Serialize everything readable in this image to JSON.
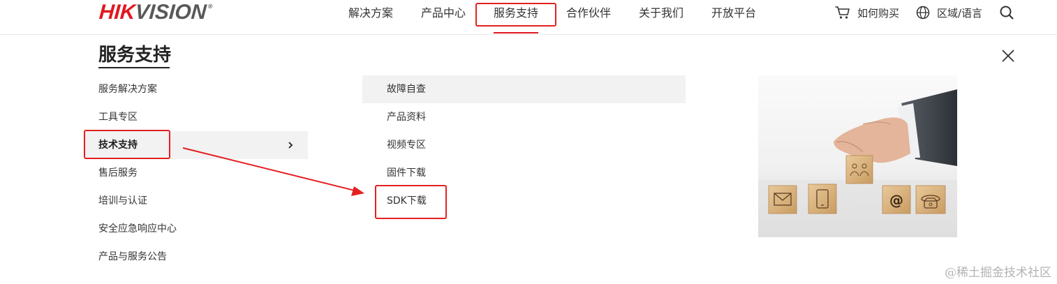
{
  "header": {
    "logo": {
      "part1": "HIK",
      "part2": "VISION",
      "registered": "®"
    },
    "nav": [
      {
        "label": "解决方案"
      },
      {
        "label": "产品中心"
      },
      {
        "label": "服务支持",
        "active": true
      },
      {
        "label": "合作伙伴"
      },
      {
        "label": "关于我们"
      },
      {
        "label": "开放平台"
      }
    ],
    "utilities": {
      "buy_label": "如何购买",
      "region_label": "区域/语言"
    }
  },
  "menu": {
    "title": "服务支持",
    "left_items": [
      {
        "label": "服务解决方案"
      },
      {
        "label": "工具专区"
      },
      {
        "label": "技术支持",
        "active": true
      },
      {
        "label": "售后服务"
      },
      {
        "label": "培训与认证"
      },
      {
        "label": "安全应急响应中心"
      },
      {
        "label": "产品与服务公告"
      }
    ],
    "sub_items": [
      {
        "label": "故障自查",
        "hover": true
      },
      {
        "label": "产品资料"
      },
      {
        "label": "视频专区"
      },
      {
        "label": "固件下载"
      },
      {
        "label": "SDK下载"
      }
    ],
    "promo_icons": [
      "envelope-icon",
      "tablet-icon",
      "people-icon",
      "at-sign-icon",
      "telephone-icon"
    ]
  },
  "colors": {
    "brand_red": "#e0181f",
    "annotation_red": "#e3201f",
    "active_bg": "#f2f2f2"
  },
  "watermark": "@稀土掘金技术社区"
}
